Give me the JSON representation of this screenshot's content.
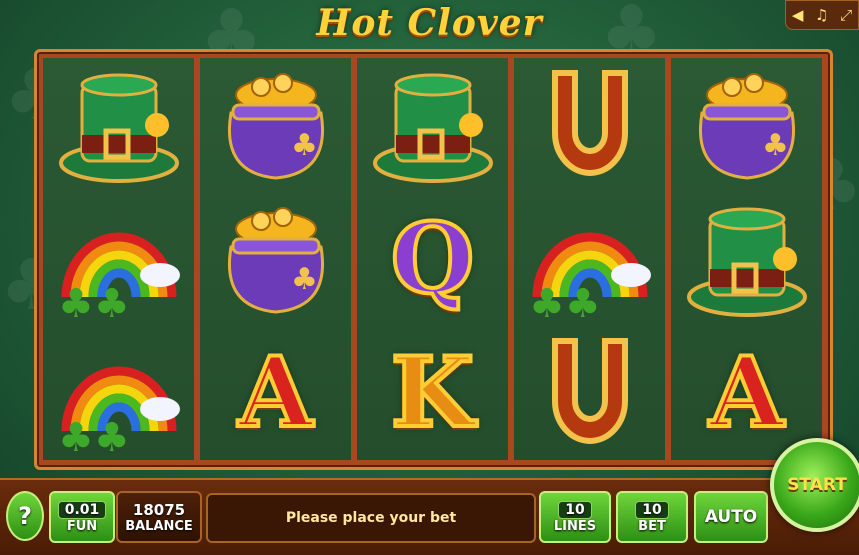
{
  "title": "Hot Clover",
  "topbar": {
    "sound_icon": "speaker-icon",
    "music_icon": "music-note-icon",
    "fullscreen_icon": "fullscreen-icon"
  },
  "reels": [
    [
      "leprechaun-hat",
      "rainbow",
      "rainbow"
    ],
    [
      "pot-of-gold",
      "pot-of-gold",
      "A"
    ],
    [
      "leprechaun-hat",
      "Q",
      "K"
    ],
    [
      "horseshoe",
      "rainbow",
      "horseshoe"
    ],
    [
      "pot-of-gold",
      "leprechaun-hat",
      "A"
    ]
  ],
  "letter_colors": {
    "A": "#d8231f",
    "K": "#e88d14",
    "Q": "#8a3fd0"
  },
  "controls": {
    "help_label": "?",
    "coin_value": "0.01",
    "coin_label": "FUN",
    "balance_value": "18075",
    "balance_label": "BALANCE",
    "message": "Please place your bet",
    "lines_value": "10",
    "lines_label": "LINES",
    "bet_value": "10",
    "bet_label": "BET",
    "auto_label": "AUTO",
    "start_label": "START"
  }
}
